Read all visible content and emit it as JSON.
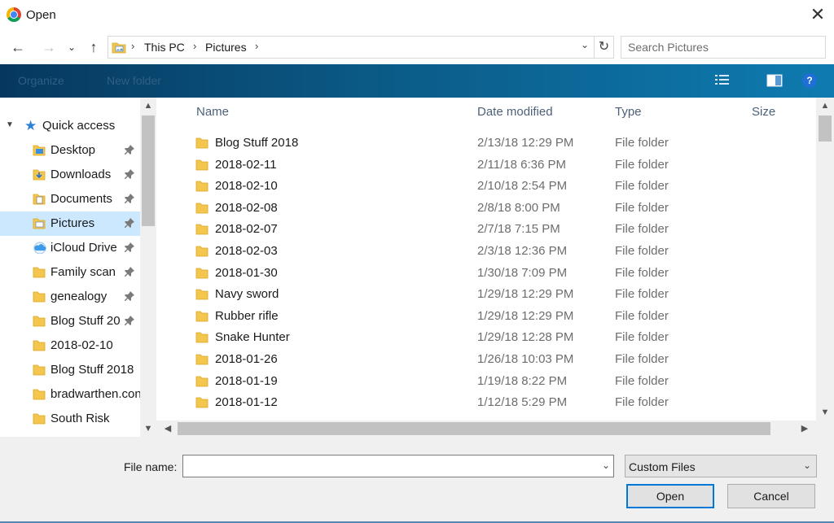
{
  "window": {
    "title": "Open"
  },
  "address": {
    "crumbs": [
      "This PC",
      "Pictures"
    ]
  },
  "search": {
    "placeholder": "Search Pictures"
  },
  "toolbar": {
    "organize": "Organize",
    "new_folder": "New folder",
    "help": "?"
  },
  "nav": {
    "quick_access": "Quick access",
    "items": [
      {
        "label": "Desktop",
        "icon": "desktop-folder-icon",
        "pinned": true
      },
      {
        "label": "Downloads",
        "icon": "downloads-folder-icon",
        "pinned": true
      },
      {
        "label": "Documents",
        "icon": "documents-folder-icon",
        "pinned": true
      },
      {
        "label": "Pictures",
        "icon": "pictures-folder-icon",
        "pinned": true,
        "selected": true
      },
      {
        "label": "iCloud Drive",
        "icon": "icloud-icon",
        "pinned": true
      },
      {
        "label": "Family scan",
        "icon": "folder-icon",
        "pinned": true
      },
      {
        "label": "genealogy",
        "icon": "folder-icon",
        "pinned": true
      },
      {
        "label": "Blog Stuff 20",
        "icon": "folder-icon",
        "pinned": true
      },
      {
        "label": "2018-02-10",
        "icon": "folder-icon",
        "pinned": false
      },
      {
        "label": "Blog Stuff 2018",
        "icon": "folder-icon",
        "pinned": false
      },
      {
        "label": "bradwarthen.con",
        "icon": "folder-icon",
        "pinned": false
      },
      {
        "label": "South Risk",
        "icon": "folder-icon",
        "pinned": false
      }
    ]
  },
  "columns": {
    "name": "Name",
    "date": "Date modified",
    "type": "Type",
    "size": "Size"
  },
  "files": [
    {
      "name": "Blog Stuff 2018",
      "date": "2/13/18 12:29 PM",
      "type": "File folder"
    },
    {
      "name": "2018-02-11",
      "date": "2/11/18 6:36 PM",
      "type": "File folder"
    },
    {
      "name": "2018-02-10",
      "date": "2/10/18 2:54 PM",
      "type": "File folder"
    },
    {
      "name": "2018-02-08",
      "date": "2/8/18 8:00 PM",
      "type": "File folder"
    },
    {
      "name": "2018-02-07",
      "date": "2/7/18 7:15 PM",
      "type": "File folder"
    },
    {
      "name": "2018-02-03",
      "date": "2/3/18 12:36 PM",
      "type": "File folder"
    },
    {
      "name": "2018-01-30",
      "date": "1/30/18 7:09 PM",
      "type": "File folder"
    },
    {
      "name": "Navy sword",
      "date": "1/29/18 12:29 PM",
      "type": "File folder"
    },
    {
      "name": "Rubber rifle",
      "date": "1/29/18 12:29 PM",
      "type": "File folder"
    },
    {
      "name": "Snake Hunter",
      "date": "1/29/18 12:28 PM",
      "type": "File folder"
    },
    {
      "name": "2018-01-26",
      "date": "1/26/18 10:03 PM",
      "type": "File folder"
    },
    {
      "name": "2018-01-19",
      "date": "1/19/18 8:22 PM",
      "type": "File folder"
    },
    {
      "name": "2018-01-12",
      "date": "1/12/18 5:29 PM",
      "type": "File folder"
    }
  ],
  "footer": {
    "file_name_label": "File name:",
    "file_name_value": "",
    "filter_value": "Custom Files",
    "open_label": "Open",
    "cancel_label": "Cancel"
  },
  "colors": {
    "accent": "#0078d7",
    "selection": "#cce8ff",
    "folder": "#f4c64d",
    "toolbar_dark": "#06385e",
    "toolbar_light": "#0e7bb0"
  }
}
